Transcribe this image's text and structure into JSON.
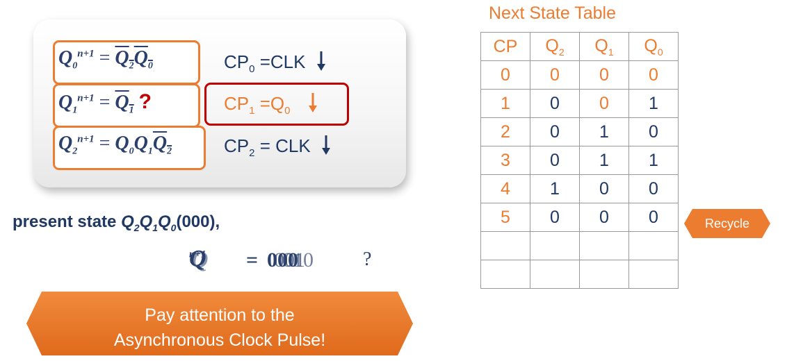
{
  "equations": {
    "q0": {
      "lhs": "Q",
      "lhs_sub": "0",
      "sup": "n+1",
      "eq": "=",
      "rhs": [
        "Q2",
        "Q0"
      ]
    },
    "q1": {
      "lhs": "Q",
      "lhs_sub": "1",
      "sup": "n+1",
      "eq": "=",
      "rhs": [
        "Q1"
      ],
      "mark": "?"
    },
    "q2": {
      "lhs": "Q",
      "lhs_sub": "2",
      "sup": "n+1",
      "eq": "=",
      "rhs": [
        "Q0",
        "Q1",
        "Q2"
      ]
    }
  },
  "clocks": [
    {
      "label": "CP",
      "sub": "0",
      "rest": " =CLK"
    },
    {
      "label": "CP",
      "sub": "1",
      "rest": " =Q",
      "rest_sub": "0"
    },
    {
      "label": "CP",
      "sub": "2",
      "rest": " = CLK"
    }
  ],
  "present": {
    "prefix": "present state ",
    "q": [
      "2",
      "1",
      "0"
    ],
    "value": "(000),"
  },
  "overlap": {
    "lhs": "Q",
    "sup": "n+1",
    "vals": [
      "000",
      "001",
      "010"
    ],
    "mark": "?"
  },
  "banner": {
    "line1": "Pay attention to the",
    "line2": "Asynchronous Clock Pulse!",
    "color": "#ec7c30"
  },
  "table": {
    "title": "Next State Table",
    "headers": [
      {
        "t": "CP"
      },
      {
        "t": "Q",
        "s": "2"
      },
      {
        "t": "Q",
        "s": "1"
      },
      {
        "t": "Q",
        "s": "0"
      }
    ],
    "rows": [
      [
        "0",
        "0",
        "0",
        "0"
      ],
      [
        "1",
        "0",
        "0",
        "1"
      ],
      [
        "2",
        "0",
        "1",
        "0"
      ],
      [
        "3",
        "0",
        "1",
        "1"
      ],
      [
        "4",
        "1",
        "0",
        "0"
      ],
      [
        "5",
        "0",
        "0",
        "0"
      ],
      [
        "",
        "",
        "",
        ""
      ],
      [
        "",
        "",
        "",
        ""
      ]
    ]
  },
  "recycle": {
    "label": "Recycle"
  },
  "colors": {
    "orange": "#ec7c30",
    "navy": "#1f3864",
    "red": "#c00000"
  }
}
